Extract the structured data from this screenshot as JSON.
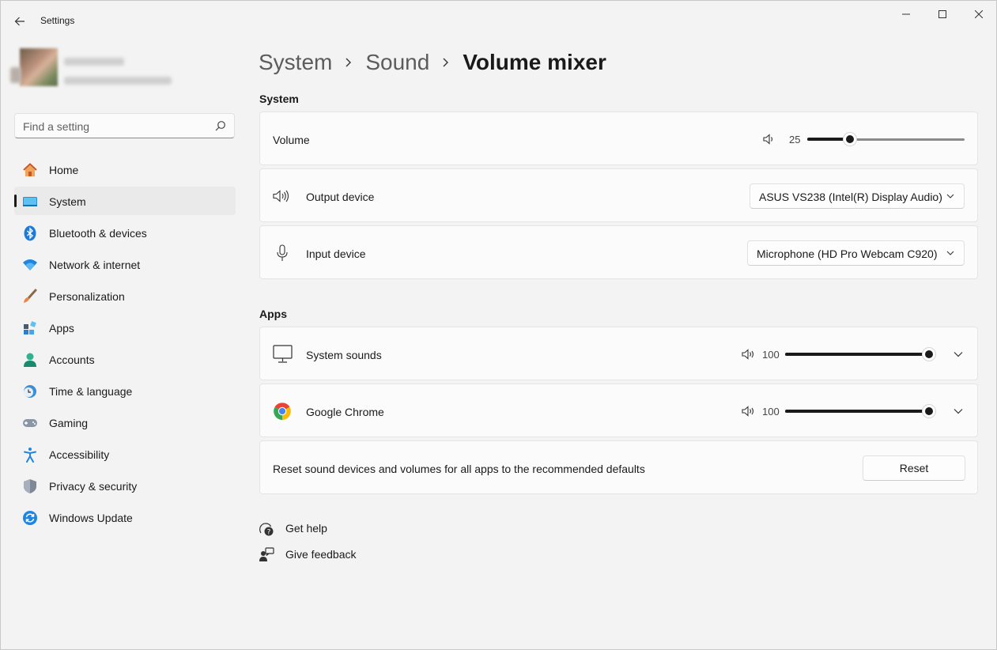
{
  "window": {
    "title": "Settings"
  },
  "search": {
    "placeholder": "Find a setting"
  },
  "nav": {
    "items": [
      {
        "label": "Home",
        "icon": "home-icon"
      },
      {
        "label": "System",
        "icon": "system-icon",
        "active": true
      },
      {
        "label": "Bluetooth & devices",
        "icon": "bluetooth-icon"
      },
      {
        "label": "Network & internet",
        "icon": "wifi-icon"
      },
      {
        "label": "Personalization",
        "icon": "brush-icon"
      },
      {
        "label": "Apps",
        "icon": "apps-icon"
      },
      {
        "label": "Accounts",
        "icon": "accounts-icon"
      },
      {
        "label": "Time & language",
        "icon": "clock-globe-icon"
      },
      {
        "label": "Gaming",
        "icon": "gamepad-icon"
      },
      {
        "label": "Accessibility",
        "icon": "accessibility-icon"
      },
      {
        "label": "Privacy & security",
        "icon": "shield-icon"
      },
      {
        "label": "Windows Update",
        "icon": "update-icon"
      }
    ]
  },
  "breadcrumb": {
    "level1": "System",
    "level2": "Sound",
    "current": "Volume mixer"
  },
  "system_section": {
    "title": "System",
    "volume": {
      "label": "Volume",
      "value": "25",
      "level": 0.25
    },
    "output": {
      "label": "Output device",
      "selected": "ASUS VS238 (Intel(R) Display Audio)"
    },
    "input": {
      "label": "Input device",
      "selected": "Microphone (HD Pro Webcam C920)"
    }
  },
  "apps_section": {
    "title": "Apps",
    "apps": [
      {
        "label": "System sounds",
        "value": "100",
        "level": 1.0,
        "icon": "monitor-icon"
      },
      {
        "label": "Google Chrome",
        "value": "100",
        "level": 1.0,
        "icon": "chrome-icon"
      }
    ]
  },
  "reset": {
    "description": "Reset sound devices and volumes for all apps to the recommended defaults",
    "button": "Reset"
  },
  "links": {
    "help": "Get help",
    "feedback": "Give feedback"
  },
  "colors": {
    "accent": "#1a1a1a",
    "background": "#f3f3f3",
    "card": "#fbfbfb"
  }
}
